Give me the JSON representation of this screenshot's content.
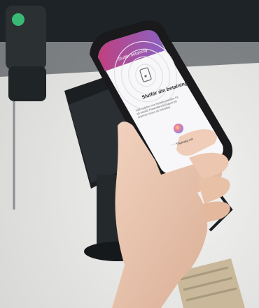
{
  "app": {
    "title": "Slutför betalning"
  },
  "screen": {
    "heading": "Slutför din betalning",
    "body": "Håll mobilen mot betalterminalen för att betala. Kontrollera beloppet på skärmen innan du bekräftar.",
    "link_label": "Tillgänglig info"
  },
  "colors": {
    "gradient_start": "#c0407f",
    "gradient_end": "#8a62c4",
    "background": "#ededeb"
  },
  "icons": {
    "phone_illustration": "phone-icon",
    "color_dot": "color-dot-icon"
  }
}
